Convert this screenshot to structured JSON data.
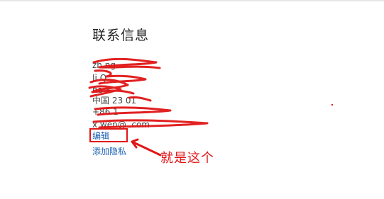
{
  "section": {
    "title": "联系信息",
    "lines": [
      "zh      ng",
      "Ji   Q",
      "na      x",
      "中国 23   01",
      "+86 1    ",
      "x      wen@     .com"
    ]
  },
  "links": {
    "edit": "编辑",
    "privacy": "添加隐私"
  },
  "annotation": {
    "text": "就是这个",
    "color": "#e01616"
  },
  "colors": {
    "link": "#1a5fb4",
    "redaction": "#e01616"
  }
}
